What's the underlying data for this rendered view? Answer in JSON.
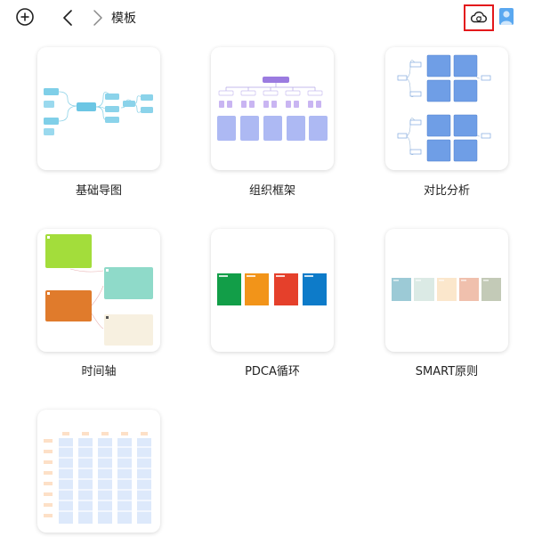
{
  "breadcrumb": "模板",
  "icons": {
    "add": "add-circle-icon",
    "back": "chevron-left-icon",
    "forward": "chevron-right-icon",
    "cloud": "cloud-sync-icon",
    "avatar": "user-avatar-icon"
  },
  "colors": {
    "highlight": "#e3181b",
    "avatar": "#5aa8f0"
  },
  "templates": [
    {
      "title": "基础导图"
    },
    {
      "title": "组织框架"
    },
    {
      "title": "对比分析"
    },
    {
      "title": "时间轴"
    },
    {
      "title": "PDCA循环"
    },
    {
      "title": "SMART原则"
    },
    {
      "title": ""
    }
  ]
}
